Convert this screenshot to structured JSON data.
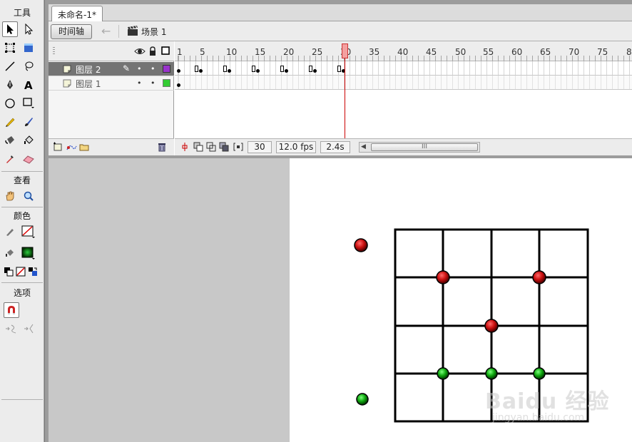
{
  "tools_panel": {
    "tools_label": "工具",
    "view_label": "查看",
    "colors_label": "颜色",
    "options_label": "选项"
  },
  "document": {
    "tab_title": "未命名-1*"
  },
  "scene_bar": {
    "timeline_button": "时间轴",
    "scene_label": "场景 1"
  },
  "timeline": {
    "ruler_labels": [
      "1",
      "5",
      "10",
      "15",
      "20",
      "25",
      "30",
      "35",
      "40",
      "45",
      "50",
      "55",
      "60",
      "65",
      "70",
      "75",
      "8"
    ],
    "layers": [
      {
        "name": "图层 2",
        "color": "#9933cc",
        "active": true
      },
      {
        "name": "图层 1",
        "color": "#33cc33",
        "active": false
      }
    ],
    "current_frame": "30",
    "fps": "12.0 fps",
    "elapsed": "2.4s",
    "scroll_thumb": "III"
  },
  "stage": {
    "grid_color": "#000000",
    "red_ball_color": "#cc1111",
    "green_ball_color": "#11aa11",
    "watermark": "Baidu 经验",
    "watermark_sub": "jingyan.baidu.com"
  }
}
